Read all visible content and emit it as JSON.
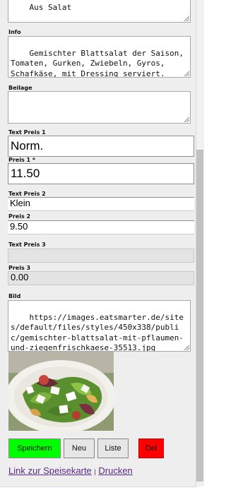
{
  "form": {
    "top_textarea_value": "Aus Salat",
    "info": {
      "label": "Info",
      "value": "Gemischter Blattsalat der Saison,\nTomaten, Gurken, Zwiebeln, Gyros,\nSchafkäse, mit Dressing serviert."
    },
    "beilage": {
      "label": "Beilage",
      "value": ""
    },
    "text_preis_1": {
      "label": "Text Preis 1",
      "value": "Norm."
    },
    "preis_1": {
      "label": "Preis 1 *",
      "value": "11.50"
    },
    "text_preis_2": {
      "label": "Text Preis 2",
      "value": "Klein"
    },
    "preis_2": {
      "label": "Preis 2",
      "value": "9.50"
    },
    "text_preis_3": {
      "label": "Text Preis 3",
      "value": ""
    },
    "preis_3": {
      "label": "Preis 3",
      "value": "0.00"
    },
    "bild": {
      "label": "Bild",
      "value": "https://images.eatsmarter.de/sites/default/files/styles/450x338/public/gemischter-blattsalat-mit-pflaumen-und-ziegenfrischkaese-35513.jpg"
    }
  },
  "buttons": {
    "speichern": "Speichern",
    "neu": "Neu",
    "liste": "Liste",
    "del": "Del"
  },
  "links": {
    "speisekarte": "Link zur Speisekarte",
    "separator": "|",
    "drucken": "Drucken"
  },
  "colors": {
    "speichern_bg": "#00ff00",
    "del_bg": "#ff0000",
    "neutral_button_bg": "#e6e6e6",
    "link_color": "#5b2a86"
  }
}
